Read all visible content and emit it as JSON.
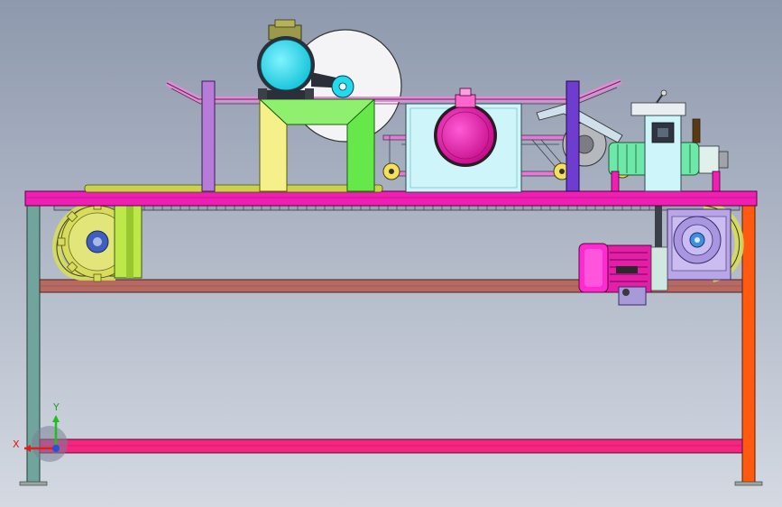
{
  "viewport": {
    "background_top": "#8e99ad",
    "background_bottom": "#d4d9e2"
  },
  "colors": {
    "table_top": "#f01fb3",
    "stretcher": "#b76a62",
    "bottom_bar": "#f4267f",
    "leg_left": "#6fa59c",
    "leg_right": "#ff5a10",
    "motor_cyan": "#22d9ee",
    "motor_magenta": "#e31fa8",
    "gear_yellow": "#d7dc5c",
    "bracket_yellow": "#f5f08a",
    "bracket_green": "#66e84a",
    "housing_light": "#cdf5fa",
    "post_purple": "#b77bd8",
    "post_violet": "#6f3cd0",
    "disc_white": "#f4f4f6",
    "gearbox_lavender": "#b9a6e8",
    "roller_yellow": "#f3e05c"
  },
  "triad": {
    "x_label": "X",
    "y_label": "Y",
    "x_color": "#e11e1e",
    "y_color": "#1fbf1f",
    "z_color": "#2a4fd8"
  },
  "icons": {
    "view_triad": "axis-triad-icon"
  }
}
